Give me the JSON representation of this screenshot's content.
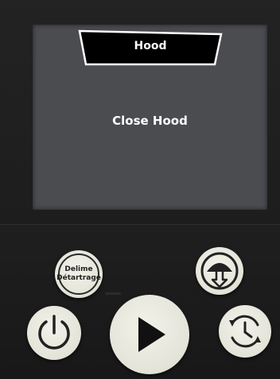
{
  "screen": {
    "title": "Hood",
    "message": "Close Hood"
  },
  "buttons": {
    "descale": {
      "line1": "Delime",
      "line2": "Détartrage",
      "icon": "descale-label-icon"
    },
    "hood": {
      "icon": "hood-icon"
    },
    "power": {
      "icon": "power-icon"
    },
    "start": {
      "icon": "play-icon"
    },
    "timer": {
      "icon": "timer-cycle-icon"
    }
  },
  "colors": {
    "screen_bg": "#4a4c50",
    "screen_text": "#ffffff",
    "button_face": "#e8e8de",
    "button_icon": "#222222"
  }
}
